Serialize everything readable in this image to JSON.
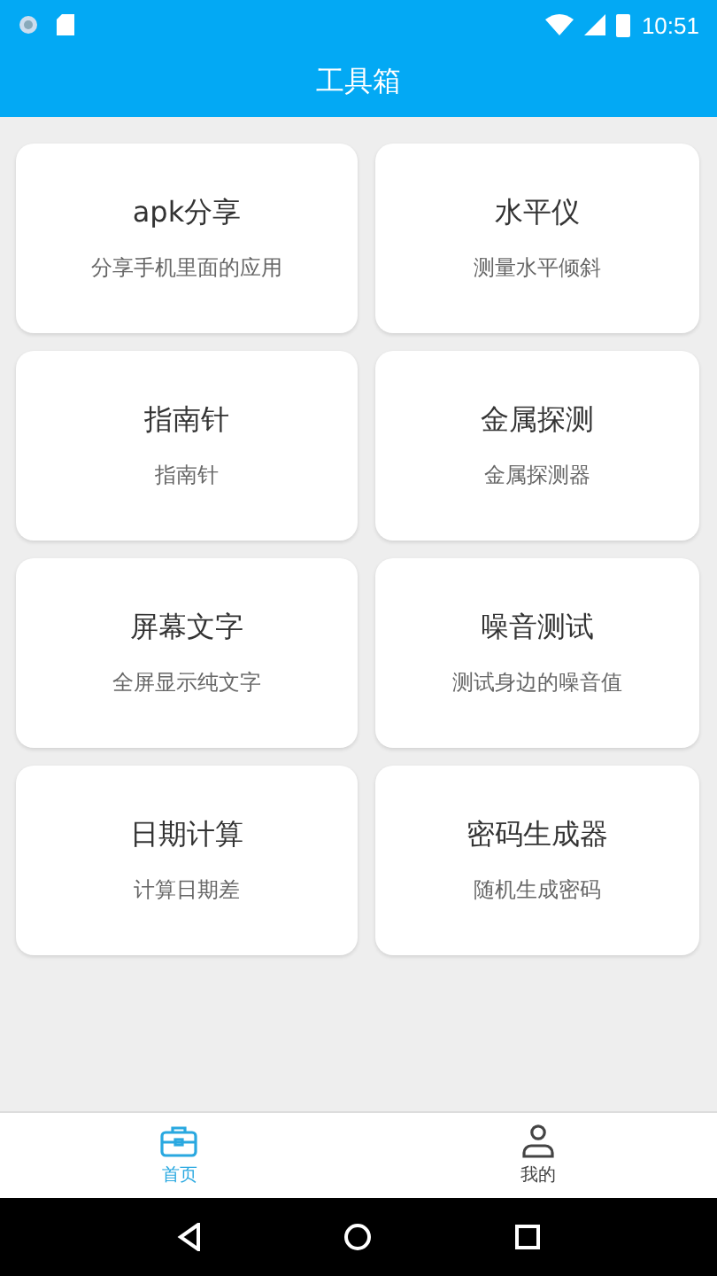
{
  "status_bar": {
    "time": "10:51"
  },
  "app_bar": {
    "title": "工具箱"
  },
  "tools": [
    {
      "title": "apk分享",
      "subtitle": "分享手机里面的应用"
    },
    {
      "title": "水平仪",
      "subtitle": "测量水平倾斜"
    },
    {
      "title": "指南针",
      "subtitle": "指南针"
    },
    {
      "title": "金属探测",
      "subtitle": "金属探测器"
    },
    {
      "title": "屏幕文字",
      "subtitle": "全屏显示纯文字"
    },
    {
      "title": "噪音测试",
      "subtitle": "测试身边的噪音值"
    },
    {
      "title": "日期计算",
      "subtitle": "计算日期差"
    },
    {
      "title": "密码生成器",
      "subtitle": "随机生成密码"
    }
  ],
  "bottom_nav": [
    {
      "label": "首页",
      "kind": "toolbox",
      "selected": true
    },
    {
      "label": "我的",
      "kind": "person",
      "selected": false
    }
  ]
}
